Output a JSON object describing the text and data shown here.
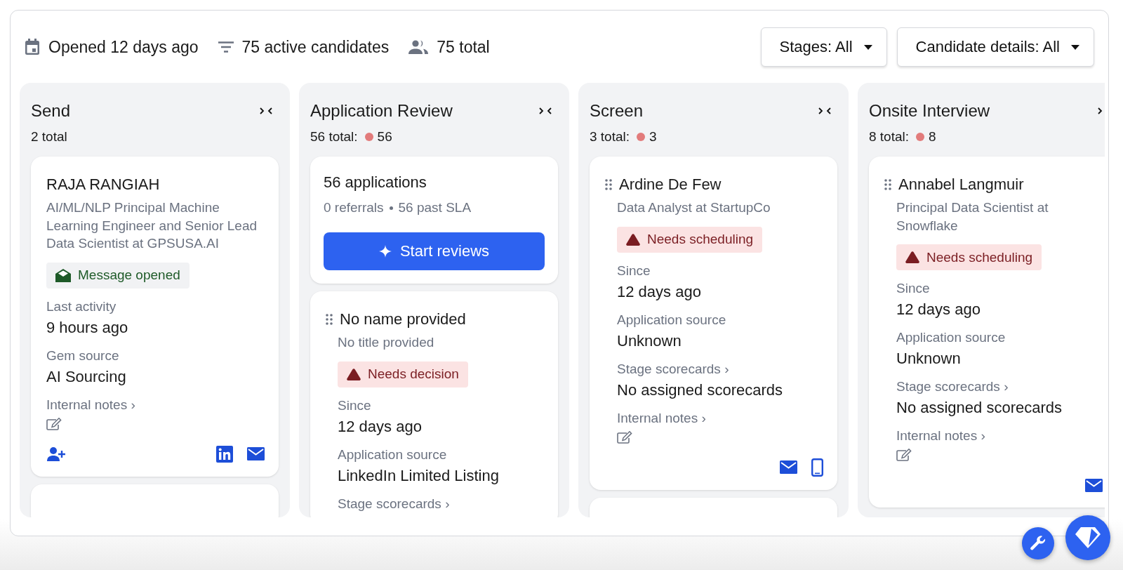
{
  "header": {
    "stats": [
      {
        "kind": "calendar",
        "text": "Opened 12 days ago"
      },
      {
        "kind": "filter",
        "text": "75 active candidates"
      },
      {
        "kind": "people",
        "text": "75 total"
      }
    ],
    "dropdowns": [
      {
        "label": "Stages: All"
      },
      {
        "label": "Candidate details: All"
      }
    ]
  },
  "columns": [
    {
      "title": "Send",
      "total": "2 total",
      "more_cards": true,
      "cards": [
        {
          "kind": "candidate",
          "draggable": false,
          "name": "RAJA RANGIAH",
          "subtitle": "AI/ML/NLP Principal Machine Learning Engineer and Senior Lead Data Scientist at GPSUSA.AI",
          "badge": {
            "kind": "message",
            "text": "Message opened"
          },
          "fields": [
            {
              "label": "Last activity",
              "value": "9 hours ago"
            },
            {
              "label": "Gem source",
              "value": "AI Sourcing"
            }
          ],
          "notes": "Internal notes ›",
          "actions": [
            {
              "kind": "add-person"
            },
            {
              "kind": "linkedin"
            },
            {
              "kind": "email"
            }
          ]
        }
      ]
    },
    {
      "title": "Application Review",
      "total": "56 total:",
      "alert": "56",
      "more_cards": false,
      "cards": [
        {
          "kind": "summary",
          "title": "56 applications",
          "stats": [
            "0 referrals",
            "56 past SLA"
          ],
          "button": "Start reviews"
        },
        {
          "kind": "candidate",
          "draggable": true,
          "name": "No name provided",
          "subtitle": "No title provided",
          "badge": {
            "kind": "alert",
            "text": "Needs decision"
          },
          "fields": [
            {
              "label": "Since",
              "value": "12 days ago"
            },
            {
              "label": "Application source",
              "value": "LinkedIn Limited Listing"
            },
            {
              "label": "Stage scorecards ›"
            }
          ]
        }
      ]
    },
    {
      "title": "Screen",
      "total": "3 total:",
      "alert": "3",
      "more_cards": true,
      "cards": [
        {
          "kind": "candidate",
          "draggable": true,
          "name": "Ardine De Few",
          "subtitle": "Data Analyst at StartupCo",
          "badge": {
            "kind": "alert",
            "text": "Needs scheduling"
          },
          "fields": [
            {
              "label": "Since",
              "value": "12 days ago"
            },
            {
              "label": "Application source",
              "value": "Unknown"
            },
            {
              "label": "Stage scorecards ›",
              "value": "No assigned scorecards"
            }
          ],
          "notes": "Internal notes ›",
          "actions": [
            {
              "kind": "email"
            },
            {
              "kind": "phone"
            }
          ]
        }
      ]
    },
    {
      "title": "Onsite Interview",
      "total": "8 total:",
      "alert": "8",
      "more_cards": false,
      "cards": [
        {
          "kind": "candidate",
          "draggable": true,
          "name": "Annabel Langmuir",
          "subtitle": "Principal Data Scientist at Snowflake",
          "badge": {
            "kind": "alert",
            "text": "Needs scheduling"
          },
          "fields": [
            {
              "label": "Since",
              "value": "12 days ago"
            },
            {
              "label": "Application source",
              "value": "Unknown"
            },
            {
              "label": "Stage scorecards ›",
              "value": "No assigned scorecards"
            }
          ],
          "notes": "Internal notes ›",
          "actions": [
            {
              "kind": "email"
            }
          ]
        }
      ]
    }
  ]
}
